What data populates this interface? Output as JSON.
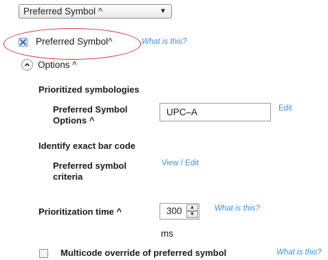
{
  "dropdown": {
    "selected": "Preferred Symbol ^"
  },
  "preferred_symbol": {
    "label": "Preferred Symbol^",
    "checked": true,
    "help": "What is this?"
  },
  "options_toggle": {
    "label": "Options ^"
  },
  "prioritized_symbologies": {
    "heading": "Prioritized symbologies",
    "options_label_line1": "Preferred Symbol",
    "options_label_line2": "Options ^",
    "value": "UPC–A",
    "edit": "Edit"
  },
  "identify_exact": {
    "heading": "Identify exact bar code",
    "criteria_label_line1": "Preferred symbol",
    "criteria_label_line2": "criteria",
    "view_edit": "View / Edit"
  },
  "prioritization_time": {
    "label": "Prioritization time ^",
    "value": "300",
    "unit": "ms",
    "help": "What is this?"
  },
  "multicode": {
    "label": "Multicode override of preferred symbol",
    "checked": false,
    "help": "What is this?"
  },
  "icons": {
    "dropdown_arrow": "chevron-down-icon",
    "options_toggle": "chevron-up-icon",
    "spin_up": "spin-up-icon",
    "spin_down": "spin-down-icon"
  },
  "colors": {
    "link": "#3b8fe0",
    "highlight_ellipse": "#d8262a",
    "checkbox_checked": "#2f6fb8"
  }
}
